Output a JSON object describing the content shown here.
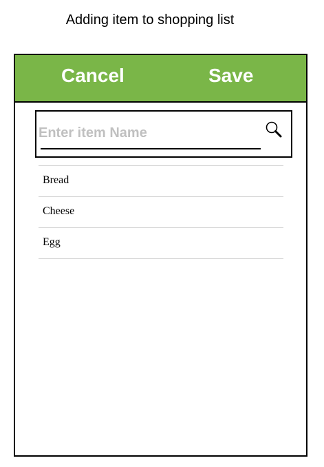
{
  "header": {
    "title": "Adding item to shopping list"
  },
  "toolbar": {
    "cancel_label": "Cancel",
    "save_label": "Save",
    "accent_color": "#7ab648"
  },
  "search": {
    "placeholder": "Enter item Name",
    "value": "",
    "icon": "search-icon"
  },
  "items": [
    {
      "label": "Bread"
    },
    {
      "label": "Cheese"
    },
    {
      "label": "Egg"
    }
  ]
}
